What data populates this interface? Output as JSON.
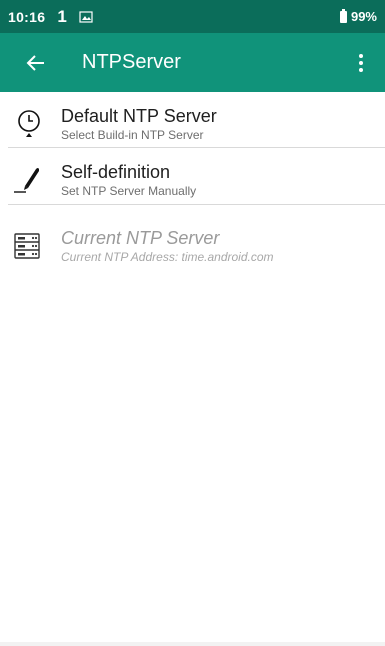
{
  "status_bar": {
    "time": "10:16",
    "sim_indicator": "1",
    "notification_icon": "image-notification-icon",
    "battery_icon": "battery-icon",
    "battery_level": "99%"
  },
  "app_bar": {
    "back_icon": "arrow-back-icon",
    "title": "NTPServer",
    "overflow_icon": "more-vert-icon"
  },
  "list": {
    "items": [
      {
        "icon": "clock-icon",
        "title": "Default NTP Server",
        "subtitle": "Select Build-in NTP Server",
        "enabled": true
      },
      {
        "icon": "pen-icon",
        "title": "Self-definition",
        "subtitle": "Set NTP Server Manually",
        "enabled": true
      },
      {
        "icon": "server-icon",
        "title": "Current NTP Server",
        "subtitle": "Current NTP Address: time.android.com",
        "enabled": false
      }
    ]
  },
  "colors": {
    "status_bar": "#0b6d5a",
    "app_bar": "#10937a",
    "background": "#ffffff"
  }
}
